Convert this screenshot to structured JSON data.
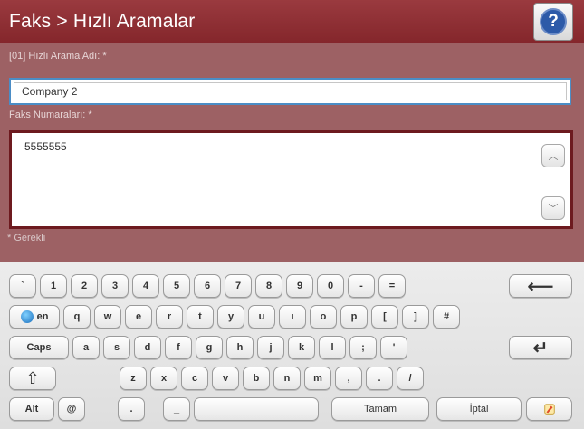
{
  "header": {
    "title": "Faks > Hızlı Aramalar",
    "help_icon": "help-icon"
  },
  "form": {
    "name_label": "[01] Hızlı Arama Adı: *",
    "name_value": "Company 2",
    "numbers_label": "Faks Numaraları: *",
    "numbers_value": "5555555",
    "required_note": "* Gerekli"
  },
  "keyboard": {
    "row1": [
      "`",
      "1",
      "2",
      "3",
      "4",
      "5",
      "6",
      "7",
      "8",
      "9",
      "0",
      "-",
      "="
    ],
    "row2_lang": "en",
    "row2": [
      "q",
      "w",
      "e",
      "r",
      "t",
      "y",
      "u",
      "ı",
      "o",
      "p",
      "[",
      "]",
      "#"
    ],
    "caps": "Caps",
    "row3": [
      "a",
      "s",
      "d",
      "f",
      "g",
      "h",
      "j",
      "k",
      "l",
      ";",
      "'"
    ],
    "shift": "⇧",
    "row4": [
      "z",
      "x",
      "c",
      "v",
      "b",
      "n",
      "m",
      ",",
      ".",
      "/"
    ],
    "alt": "Alt",
    "at": "@",
    "dot": ".",
    "underscore": "_",
    "ok": "Tamam",
    "cancel": "İptal",
    "backspace": "⟵",
    "enter": "↵"
  }
}
